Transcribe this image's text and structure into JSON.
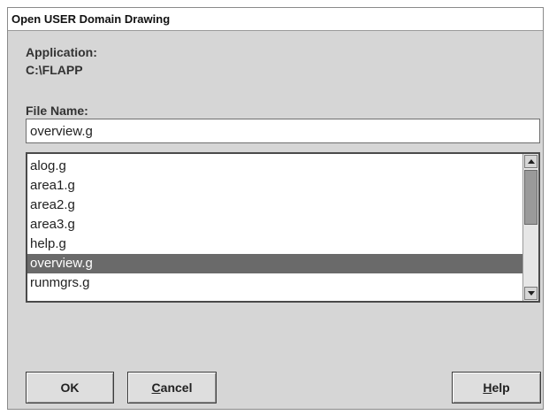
{
  "window": {
    "title": "Open USER Domain Drawing"
  },
  "application": {
    "label": "Application:",
    "value": "C:\\FLAPP"
  },
  "file": {
    "label": "File Name:",
    "value": "overview.g"
  },
  "file_list": {
    "items": [
      "alog.g",
      "area1.g",
      "area2.g",
      "area3.g",
      "help.g",
      "overview.g",
      "runmgrs.g"
    ],
    "selected_index": 5
  },
  "buttons": {
    "ok": "OK",
    "cancel_first": "C",
    "cancel_rest": "ancel",
    "help_first": "H",
    "help_rest": "elp"
  },
  "scrollbar": {
    "up_icon": "arrow-up-icon",
    "down_icon": "arrow-down-icon"
  },
  "colors": {
    "selection": "#6a6a6a",
    "dialog_bg": "#d6d6d6"
  }
}
